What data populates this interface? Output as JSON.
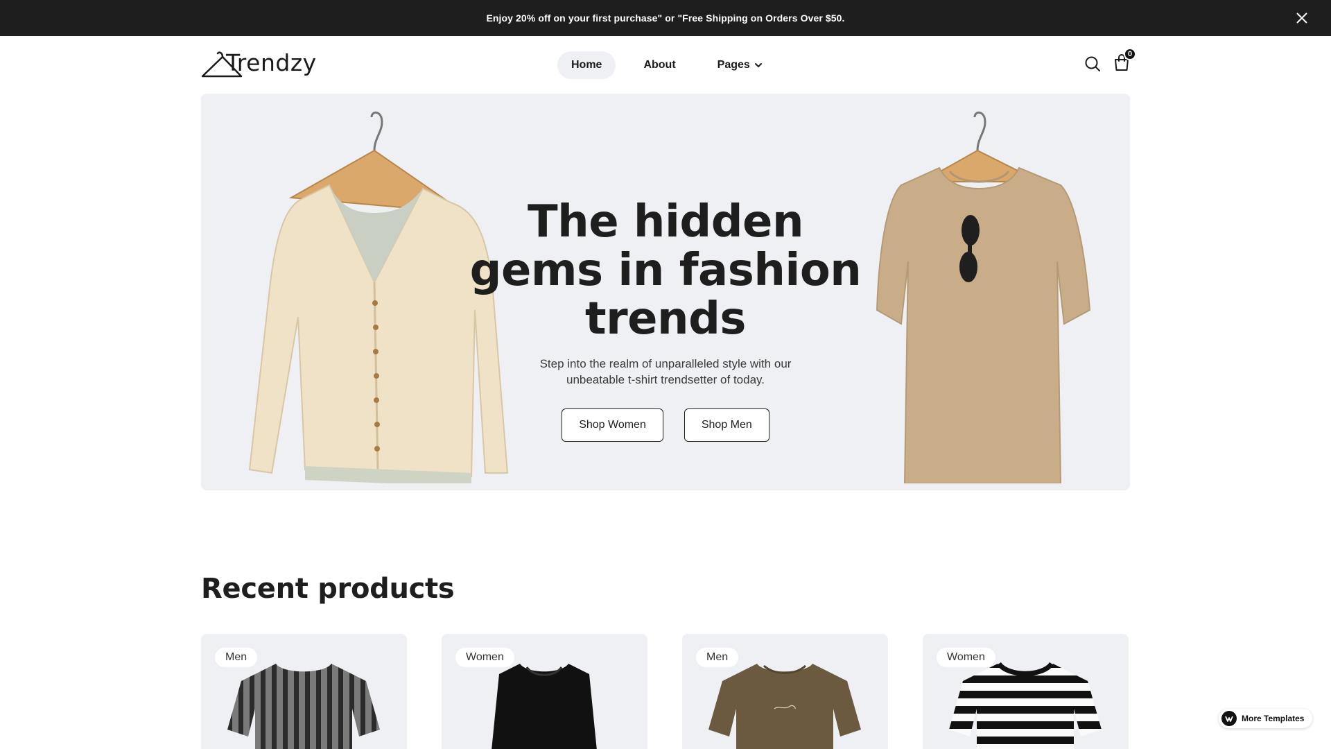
{
  "announcement": {
    "text": "Enjoy 20% off on your first purchase\" or \"Free Shipping on Orders Over $50."
  },
  "header": {
    "logo_text": "Trendzy",
    "nav": [
      {
        "label": "Home",
        "active": true
      },
      {
        "label": "About",
        "active": false
      },
      {
        "label": "Pages",
        "active": false,
        "has_dropdown": true
      }
    ],
    "cart_count": "0"
  },
  "hero": {
    "title": "The hidden gems in fashion trends",
    "subtitle": "Step into the realm of unparalleled style with our unbeatable t-shirt trendsetter of today.",
    "buttons": [
      "Shop Women",
      "Shop Men"
    ]
  },
  "recent": {
    "title": "Recent products",
    "products": [
      {
        "tag": "Men"
      },
      {
        "tag": "Women"
      },
      {
        "tag": "Men"
      },
      {
        "tag": "Women"
      }
    ]
  },
  "badge": {
    "label": "More Templates"
  },
  "colors": {
    "topbar_bg": "#1e1e1e",
    "hero_bg": "#eef0f3",
    "text_dark": "#1e1e1e"
  }
}
